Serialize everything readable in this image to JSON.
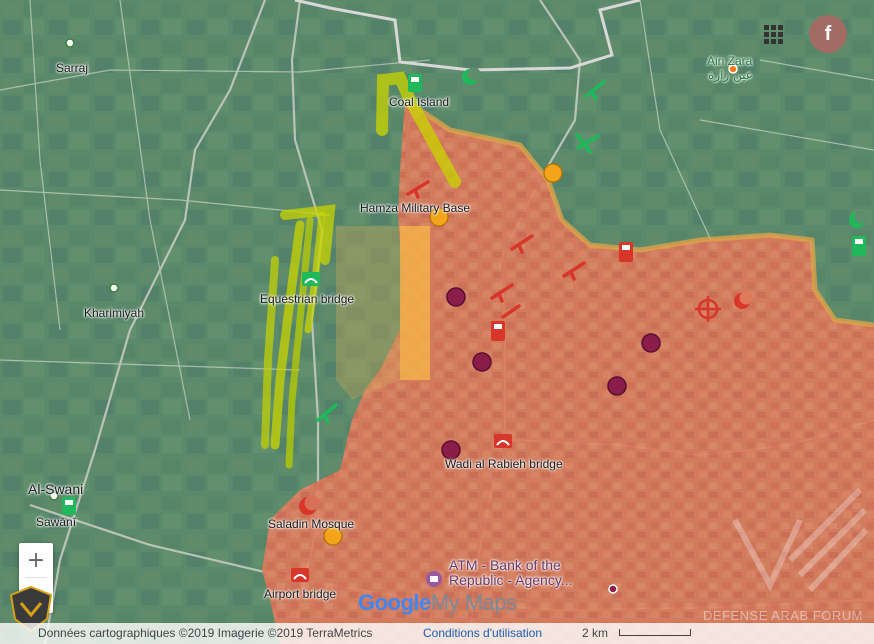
{
  "colors": {
    "terrain": "#5c8a6a",
    "control_zone": "#e07a5a",
    "contested_zone": "#f5b04a",
    "advance_arrow": "#c8d400",
    "icon_red": "#d9362b",
    "icon_green": "#1fb85a",
    "marker_yellow": "#f2a51a",
    "marker_purple": "#8a1d4a",
    "border_line": "#cfcfcf"
  },
  "places": {
    "sarraj": "Sarraj",
    "coal_island": "Coal Island",
    "hamza_base": "Hamza Military Base",
    "equestrian_bridge": "Equestrian bridge",
    "kharimiyah": "Kharimiyah",
    "al_swani_latin": "Al-Swani",
    "sawani": "Sawānī",
    "saladin_mosque": "Saladin Mosque",
    "airport_bridge": "Airport bridge",
    "wadi_bridge": "Wadi al Rabieh bridge",
    "ain_zara_latin": "Ain Zara",
    "ain_zara_arabic": "عين زارة",
    "atm_line1": "ATM - Bank of the",
    "atm_line2": "Republic - Agency..."
  },
  "map_icons": {
    "fighter_icon": "rifle-icon",
    "fuel_icon": "fuel-pump-icon",
    "mosque_icon": "crescent-icon",
    "bridge_icon": "bridge-icon",
    "target_icon": "crosshair-icon",
    "atm_icon": "atm-icon"
  },
  "controls": {
    "zoom_in": "+",
    "zoom_out": "−",
    "share_label": "f",
    "apps_icon": "grid-icon"
  },
  "footer": {
    "attribution": "Données cartographiques ©2019 Imagerie ©2019 TerraMetrics",
    "terms": "Conditions d'utilisation",
    "scale": "2 km"
  },
  "branding": {
    "google": "Google",
    "mymaps": "My Maps",
    "forum": "DEFENSE ARAB FORUM"
  }
}
